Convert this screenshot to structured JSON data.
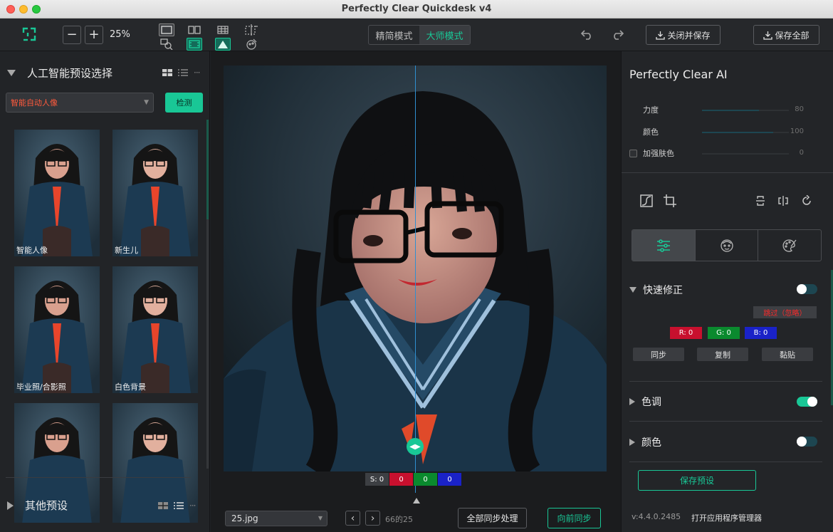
{
  "window": {
    "title": "Perfectly Clear Quickdesk v4"
  },
  "toolbar": {
    "zoom_minus": "−",
    "zoom_plus": "+",
    "zoom_value": "25%",
    "modes": [
      {
        "label": "精简模式",
        "active": false
      },
      {
        "label": "大师模式",
        "active": true
      }
    ],
    "close_save_label": "关闭并保存",
    "save_all_label": "保存全部"
  },
  "left_panel": {
    "ai_presets": {
      "title": "人工智能预设选择",
      "selected_preset": "智能自动人像",
      "detect_label": "检测",
      "thumbnails": [
        {
          "label": "智能人像"
        },
        {
          "label": "新生儿"
        },
        {
          "label": "毕业照/合影照"
        },
        {
          "label": "白色背景"
        },
        {
          "label": ""
        },
        {
          "label": ""
        }
      ]
    },
    "other_presets": {
      "title": "其他预设"
    }
  },
  "center": {
    "chips": [
      {
        "label": "S: 0",
        "color": "#3d3f43"
      },
      {
        "label": "0",
        "color": "#c8102e"
      },
      {
        "label": "0",
        "color": "#0a8a2e"
      },
      {
        "label": "0",
        "color": "#1a22c8"
      }
    ],
    "file_name": "25.jpg",
    "prev": "‹",
    "next": "›",
    "page_info": "66的25",
    "sync_all_label": "全部同步处理",
    "sync_forward_label": "向前同步"
  },
  "right_panel": {
    "ai_title": "Perfectly Clear AI",
    "sliders": [
      {
        "label": "力度",
        "value": 80
      },
      {
        "label": "颜色",
        "value": 100
      },
      {
        "label": "加强肤色",
        "value": 0
      }
    ],
    "quick_fix": {
      "title": "快速修正",
      "enabled": false,
      "skip_label": "跳过（忽略）",
      "rgb": [
        {
          "label": "R: 0",
          "color": "#c8102e"
        },
        {
          "label": "G: 0",
          "color": "#0a8a2e"
        },
        {
          "label": "B: 0",
          "color": "#1a22c8"
        }
      ],
      "buttons": [
        {
          "label": "同步"
        },
        {
          "label": "复制"
        },
        {
          "label": "黏贴"
        }
      ]
    },
    "tone": {
      "title": "色调",
      "enabled": true
    },
    "color": {
      "title": "颜色",
      "enabled": false
    },
    "save_preset_label": "保存预设",
    "version": "v:4.4.0.2485",
    "open_manager_label": "打开应用程序管理器"
  },
  "colors": {
    "accent": "#19c796",
    "warning": "#ff5a3c"
  }
}
